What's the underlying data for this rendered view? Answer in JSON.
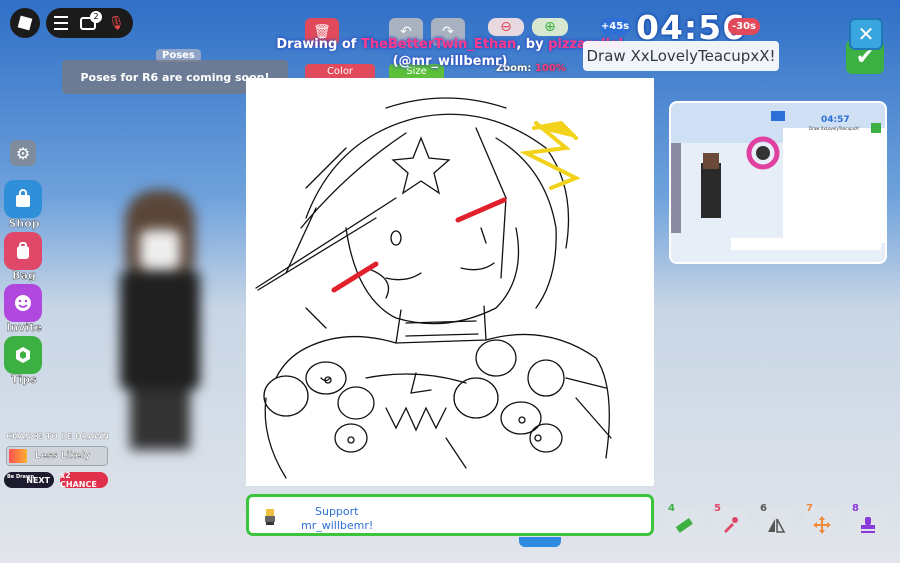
{
  "topbar": {
    "chat_badge": "2"
  },
  "poses": {
    "tag": "Poses",
    "note": "Poses for R6 are coming soon!"
  },
  "sidebar": {
    "items": [
      {
        "label": "Shop",
        "color": "#2f8fd8",
        "icon": "shopping-bag-icon"
      },
      {
        "label": "Bag",
        "color": "#e0486a",
        "icon": "backpack-icon"
      },
      {
        "label": "Invite",
        "color": "#b048e0",
        "icon": "smiley-icon"
      },
      {
        "label": "Tips",
        "color": "#3cb043",
        "icon": "lightbulb-icon"
      }
    ]
  },
  "chance": {
    "title": "CHANCE TO BE DRAWN",
    "level": "Less Likely",
    "next_label": "NEXT",
    "next_mini": "Be Drawn",
    "x2_label": "x2 CHANCE"
  },
  "drawing_title": {
    "prefix": "Drawing of ",
    "subject": "TheBetterTwin_Ethan",
    "middle": ", by ",
    "artist": "pizzarolls!",
    "handle": "(@mr_willbemr)"
  },
  "tools": {
    "color_label": "Color",
    "size_label": "Size",
    "zoom_label": "Zoom:",
    "zoom_value": "100%"
  },
  "timer": {
    "time": "04:56",
    "plus": "+45s",
    "minus": "-30s"
  },
  "prompt": "Draw XxLovelyTeacupxX!",
  "support": {
    "line1": "Support",
    "line2": "mr_willbemr!"
  },
  "bottom_tools": [
    {
      "num": "4",
      "color": "#3cb043",
      "icon": "ruler-icon"
    },
    {
      "num": "5",
      "color": "#e0486a",
      "icon": "eyedropper-icon"
    },
    {
      "num": "6",
      "color": "#555555",
      "icon": "symmetry-icon"
    },
    {
      "num": "7",
      "color": "#f08a3a",
      "icon": "move-icon"
    },
    {
      "num": "8",
      "color": "#8a3ad8",
      "icon": "stamp-icon"
    }
  ],
  "preview": {
    "timer": "04:57",
    "prompt": "Draw XxLovelyTeacupxX!"
  }
}
